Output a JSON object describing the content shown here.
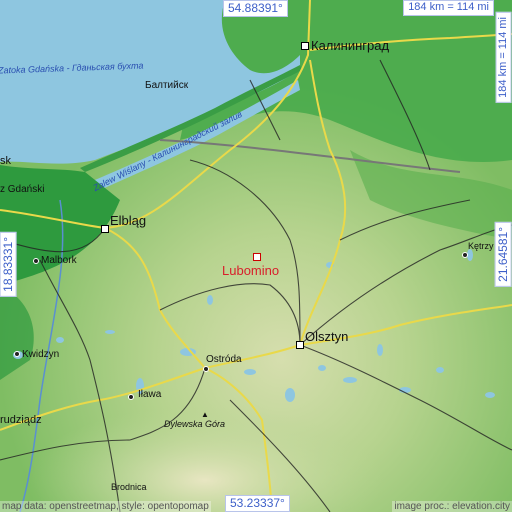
{
  "map": {
    "target_name": "Lubomino",
    "labels": {
      "kaliningrad": "Калининград",
      "baltiysk": "Балтийск",
      "gulf_gdansk": "Zatoka Gdańska - Гданьская бухта",
      "vistula_lagoon": "Zalew Wiślany - Калининградский залив",
      "elblag": "Elbląg",
      "olsztyn": "Olsztyn",
      "sk": "sk",
      "nowy_dwor": "z Gdański",
      "malbork": "Malbork",
      "kwidzyn": "Kwidzyn",
      "ostroda": "Ostróda",
      "ilawa": "Iława",
      "grudziadz": "rudziądz",
      "dylewska": "Dylewska Góra",
      "ketrzyn": "Kętrzy",
      "brodnica": "Brodnica"
    },
    "coords": {
      "top": "54.88391°",
      "bottom": "53.23337°",
      "left": "18.83331°",
      "right": "21.64581°"
    },
    "scale": {
      "horizontal": "184 km = 114 mi",
      "vertical": "184 km = 114 mi"
    },
    "credits": {
      "left": "map data: openstreetmap, style: opentopomap",
      "right": "image proc.: elevation.city"
    },
    "colors": {
      "sea": "#8ec6e0",
      "lowland": "#2e9a3e",
      "plain": "#8cc46a",
      "upland": "#d6deae",
      "target": "#d81f2b",
      "road": "#e9d94a"
    }
  }
}
